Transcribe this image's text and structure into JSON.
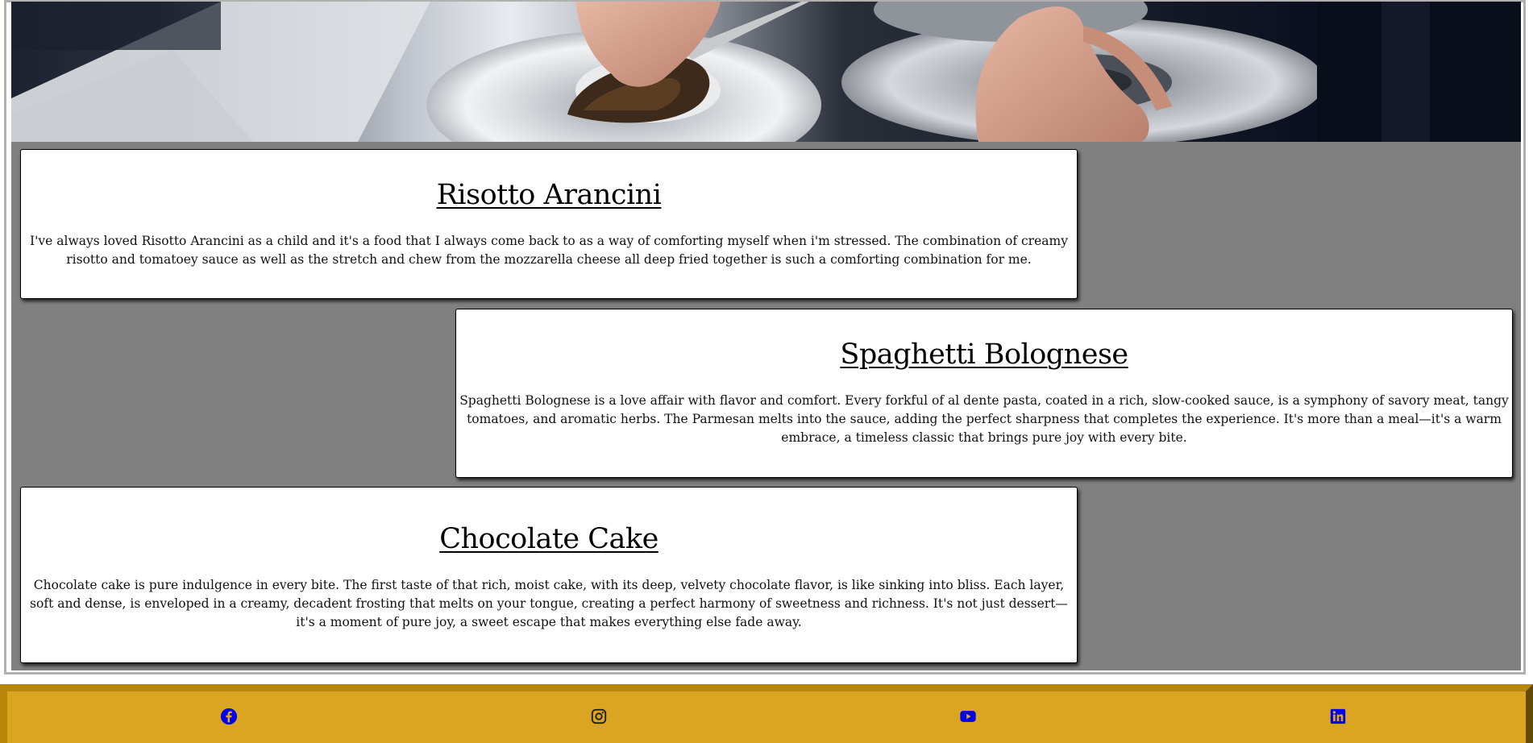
{
  "hero": {
    "alt": "Chef plating food"
  },
  "recipes": [
    {
      "title": "Risotto Arancini",
      "description": "I've always loved Risotto Arancini as a child and it's a food that I always come back to as a way of comforting myself when i'm stressed. The combination of creamy risotto and tomatoey sauce as well as the stretch and chew from the mozzarella cheese all deep fried together is such a comforting combination for me."
    },
    {
      "title": "Spaghetti Bolognese",
      "description": "Spaghetti Bolognese is a love affair with flavor and comfort. Every forkful of al dente pasta, coated in a rich, slow-cooked sauce, is a symphony of savory meat, tangy tomatoes, and aromatic herbs. The Parmesan melts into the sauce, adding the perfect sharpness that completes the experience. It's more than a meal—it's a warm embrace, a timeless classic that brings pure joy with every bite."
    },
    {
      "title": "Chocolate Cake",
      "description": "Chocolate cake is pure indulgence in every bite. The first taste of that rich, moist cake, with its deep, velvety chocolate flavor, is like sinking into bliss. Each layer, soft and dense, is enveloped in a creamy, decadent frosting that melts on your tongue, creating a perfect harmony of sweetness and richness. It's not just dessert—it's a moment of pure joy, a sweet escape that makes everything else fade away."
    }
  ],
  "footer": {
    "social": [
      {
        "name": "facebook-icon"
      },
      {
        "name": "instagram-icon"
      },
      {
        "name": "youtube-icon"
      },
      {
        "name": "linkedin-icon"
      }
    ]
  },
  "colors": {
    "background": "#808080",
    "footer": "#daa520",
    "footer_border": "#b8860b",
    "link": "#0000ee",
    "card": "#ffffff"
  }
}
